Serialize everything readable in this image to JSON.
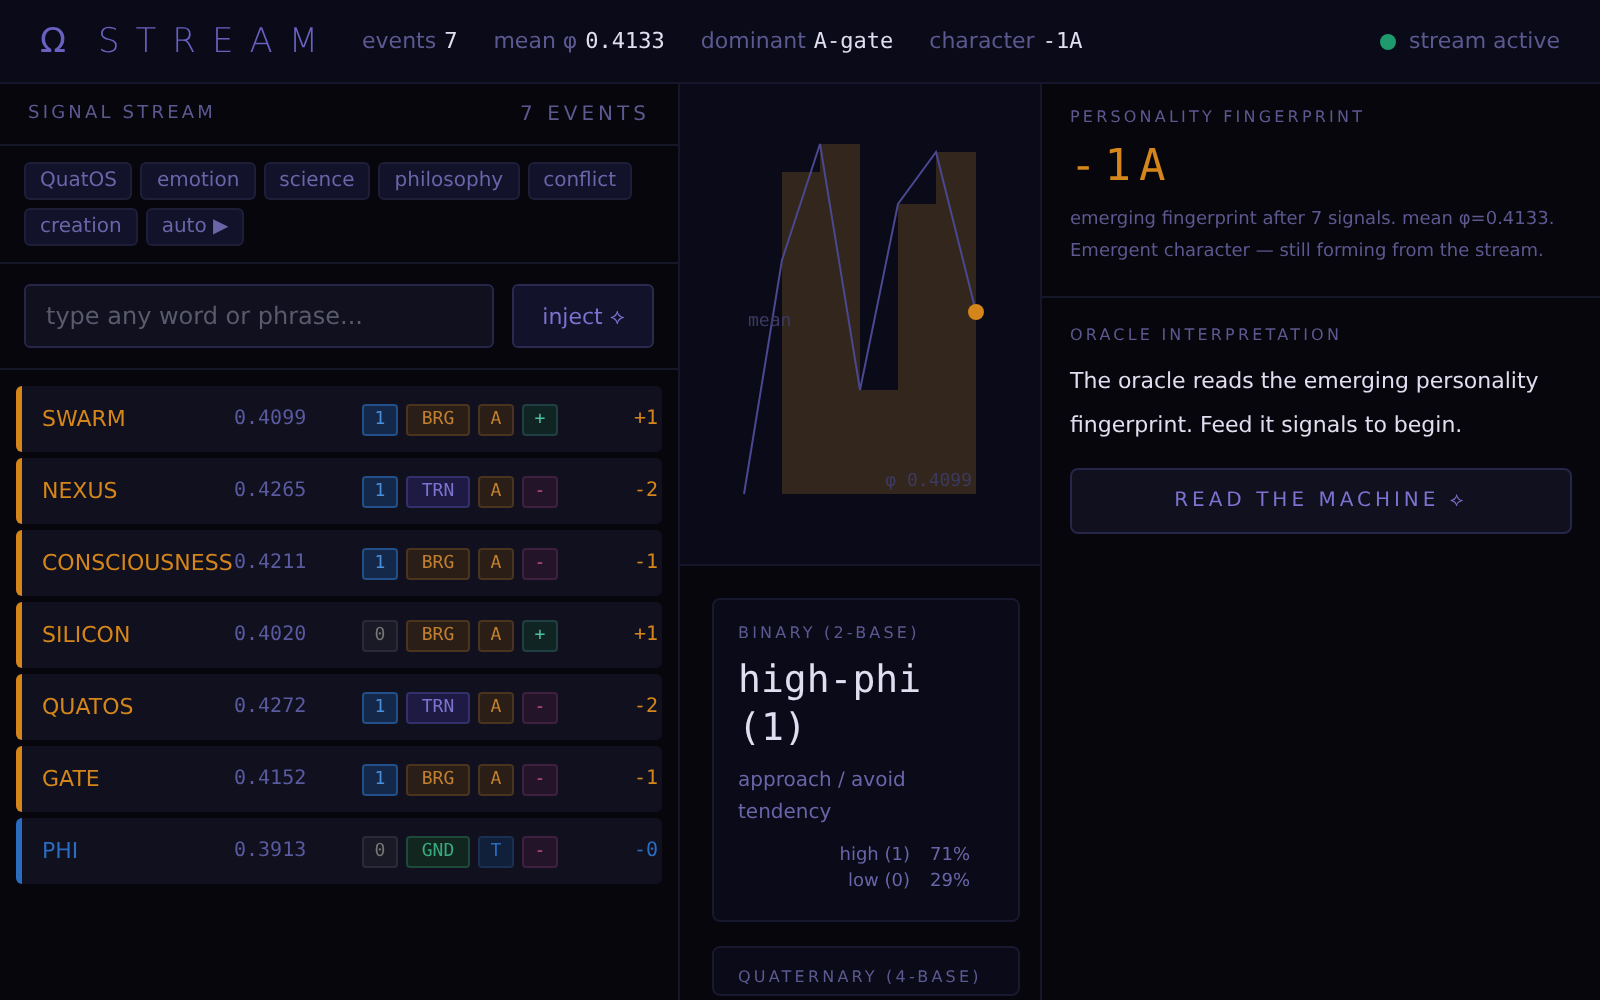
{
  "header": {
    "logo": "Ω",
    "title": "STREAM",
    "stats": [
      {
        "label": "events",
        "value": "7"
      },
      {
        "label": "mean φ",
        "value": "0.4133"
      },
      {
        "label": "dominant",
        "value": "A-gate"
      },
      {
        "label": "character",
        "value": "-1A"
      }
    ],
    "status": {
      "label": "stream active",
      "on": true
    }
  },
  "stream": {
    "title": "SIGNAL STREAM",
    "count": "7 EVENTS",
    "presets": [
      {
        "label": "QuatOS"
      },
      {
        "label": "emotion"
      },
      {
        "label": "science"
      },
      {
        "label": "philosophy"
      },
      {
        "label": "conflict"
      },
      {
        "label": "creation"
      },
      {
        "label": "auto ▶"
      }
    ],
    "input": {
      "placeholder": "type any word or phrase..."
    },
    "inject": "inject ⟡",
    "rows": [
      {
        "word": "SWARM",
        "phi": "0.4099",
        "bit": "1",
        "gate": "BRG",
        "letter": "A",
        "sign": "+",
        "delta": "+1",
        "color": "#d4861a"
      },
      {
        "word": "NEXUS",
        "phi": "0.4265",
        "bit": "1",
        "gate": "TRN",
        "letter": "A",
        "sign": "-",
        "delta": "-2",
        "color": "#d4861a"
      },
      {
        "word": "CONSCIOUSNESS",
        "phi": "0.4211",
        "bit": "1",
        "gate": "BRG",
        "letter": "A",
        "sign": "-",
        "delta": "-1",
        "color": "#d4861a"
      },
      {
        "word": "SILICON",
        "phi": "0.4020",
        "bit": "0",
        "gate": "BRG",
        "letter": "A",
        "sign": "+",
        "delta": "+1",
        "color": "#d4861a"
      },
      {
        "word": "QUATOS",
        "phi": "0.4272",
        "bit": "1",
        "gate": "TRN",
        "letter": "A",
        "sign": "-",
        "delta": "-2",
        "color": "#d4861a"
      },
      {
        "word": "GATE",
        "phi": "0.4152",
        "bit": "1",
        "gate": "BRG",
        "letter": "A",
        "sign": "-",
        "delta": "-1",
        "color": "#d4861a"
      },
      {
        "word": "PHI",
        "phi": "0.3913",
        "bit": "0",
        "gate": "GND",
        "letter": "T",
        "sign": "-",
        "delta": "-0",
        "color": "#2a6cc0"
      }
    ]
  },
  "plot": {
    "mean_label": "mean",
    "reading": "φ 0.4099"
  },
  "binary": {
    "label": "BINARY (2-BASE)",
    "value": "high-phi (1)",
    "description": "approach / avoid tendency",
    "shares": [
      {
        "label": "high (1)",
        "value": "71%"
      },
      {
        "label": "low (0)",
        "value": "29%"
      }
    ]
  },
  "quaternary": {
    "label": "QUATERNARY (4-BASE)"
  },
  "fingerprint": {
    "label": "PERSONALITY FINGERPRINT",
    "value": "-1A",
    "text": "emerging fingerprint after 7 signals. mean φ=0.4133. Emergent character — still forming from the stream."
  },
  "oracle": {
    "label": "ORACLE INTERPRETATION",
    "text": "The oracle reads the emerging personality fingerprint. Feed it signals to begin.",
    "button": "READ THE MACHINE ⟡"
  }
}
